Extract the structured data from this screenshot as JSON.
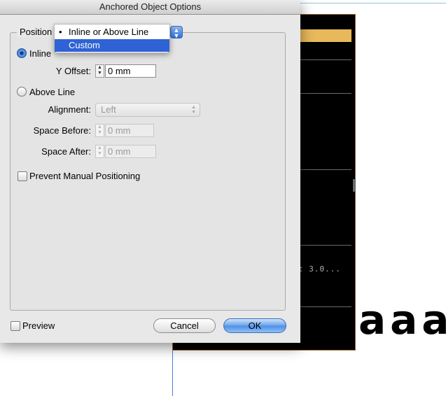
{
  "dialog": {
    "title": "Anchored Object Options",
    "position_label": "Position",
    "position_menu": {
      "options": [
        "Inline or Above Line",
        "Custom"
      ],
      "selected": "Inline or Above Line",
      "highlighted": "Custom",
      "bullet": "•"
    },
    "inline": {
      "label": "Inline",
      "selected": true
    },
    "y_offset": {
      "label": "Y Offset:",
      "value": "0 mm"
    },
    "above_line": {
      "label": "Above Line",
      "selected": false
    },
    "alignment": {
      "label": "Alignment:",
      "value": "Left"
    },
    "space_before": {
      "label": "Space Before:",
      "value": "0 mm"
    },
    "space_after": {
      "label": "Space After:",
      "value": "0 mm"
    },
    "prevent_manual": {
      "label": "Prevent Manual Positioning",
      "checked": false
    },
    "preview": {
      "label": "Preview",
      "checked": false
    },
    "cancel_label": "Cancel",
    "ok_label": "OK"
  },
  "document": {
    "garbled_text": "t 3.0...",
    "large_glyphs": "aaa"
  }
}
